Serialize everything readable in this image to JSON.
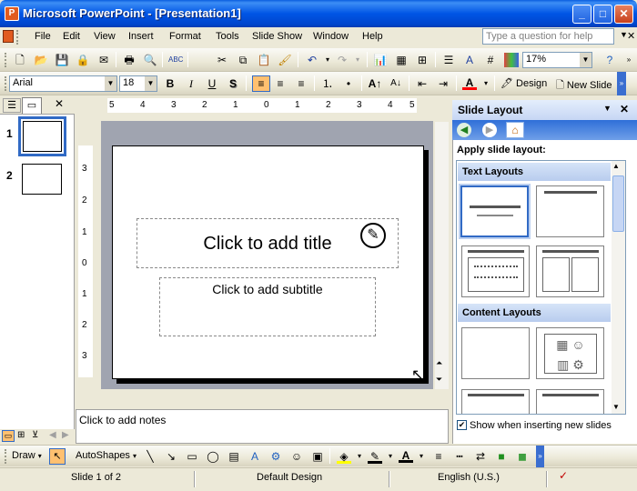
{
  "window": {
    "title": "Microsoft PowerPoint - [Presentation1]",
    "app_icon_letter": "P",
    "minimize": "_",
    "maximize": "□",
    "close": "✕"
  },
  "menubar": {
    "items": [
      "File",
      "Edit",
      "View",
      "Insert",
      "Format",
      "Tools",
      "Slide Show",
      "Window",
      "Help"
    ],
    "help_placeholder": "Type a question for help",
    "doc_close": "✕"
  },
  "standard_toolbar": {
    "zoom": "17%",
    "icons": [
      "new-icon",
      "open-icon",
      "save-icon",
      "permission-icon",
      "email-icon",
      "print-icon",
      "print-preview-icon",
      "spelling-icon",
      "cut-icon",
      "copy-icon",
      "paste-icon",
      "format-painter-icon",
      "undo-icon",
      "redo-icon",
      "insert-chart-icon",
      "insert-table-icon",
      "tables-borders-icon",
      "expand-all-icon",
      "show-formatting-icon",
      "grid-icon",
      "color-grayscale-icon",
      "help-icon"
    ]
  },
  "formatting_toolbar": {
    "font": "Arial",
    "font_size": "18",
    "bold": "B",
    "italic": "I",
    "underline": "U",
    "shadow": "S",
    "design": "Design",
    "new_slide": "New Slide"
  },
  "outline_pane": {
    "slides": [
      {
        "number": "1",
        "selected": true
      },
      {
        "number": "2",
        "selected": false
      }
    ],
    "close": "✕"
  },
  "rulers": {
    "horizontal_ticks": [
      "5",
      "4",
      "3",
      "2",
      "1",
      "0",
      "1",
      "2",
      "3",
      "4",
      "5"
    ],
    "vertical_ticks": [
      "3",
      "2",
      "1",
      "0",
      "1",
      "2",
      "3"
    ]
  },
  "slide": {
    "title_placeholder": "Click to add title",
    "subtitle_placeholder": "Click to add subtitle"
  },
  "notes": {
    "placeholder": "Click to add notes"
  },
  "task_pane": {
    "title": "Slide Layout",
    "apply_label": "Apply slide layout:",
    "sections": [
      {
        "name": "Text Layouts"
      },
      {
        "name": "Content Layouts"
      }
    ],
    "show_when_inserting": "Show when inserting new slides",
    "show_when_inserting_checked": true
  },
  "drawing_toolbar": {
    "draw": "Draw",
    "autoshapes": "AutoShapes"
  },
  "status_bar": {
    "slide_info": "Slide 1 of 2",
    "design": "Default Design",
    "language": "English (U.S.)"
  },
  "colors": {
    "titlebar": "#0055e5",
    "selection": "#316ac5",
    "font_color_underline": "#ff0000",
    "highlight_yellow": "#ffff00"
  }
}
